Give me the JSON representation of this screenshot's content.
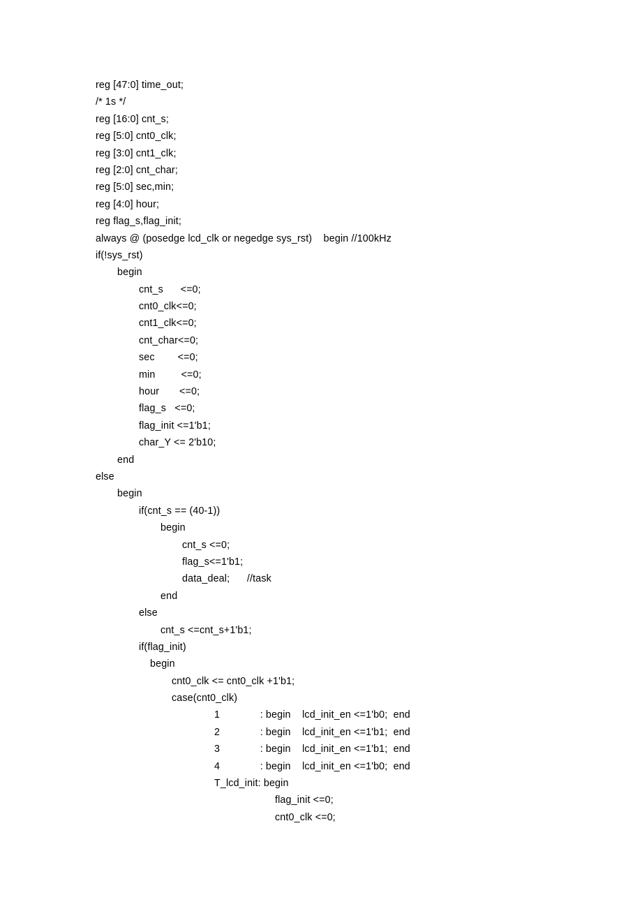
{
  "document": {
    "type": "verilog-source-listing",
    "page_background": "#ffffff",
    "text_color": "#000000"
  },
  "code": {
    "language": "verilog",
    "lines": [
      {
        "indent": "i0",
        "text": "reg [47:0] time_out;"
      },
      {
        "indent": "i0",
        "text": "/* 1s */"
      },
      {
        "indent": "i0",
        "text": "reg [16:0] cnt_s;"
      },
      {
        "indent": "i0",
        "text": "reg [5:0] cnt0_clk;"
      },
      {
        "indent": "i0",
        "text": "reg [3:0] cnt1_clk;"
      },
      {
        "indent": "i0",
        "text": "reg [2:0] cnt_char;"
      },
      {
        "indent": "i0",
        "text": "reg [5:0] sec,min;"
      },
      {
        "indent": "i0",
        "text": "reg [4:0] hour;"
      },
      {
        "indent": "i0",
        "text": "reg flag_s,flag_init;"
      },
      {
        "indent": "i0",
        "text": "always @ (posedge lcd_clk or negedge sys_rst)    begin //100kHz"
      },
      {
        "indent": "i0",
        "text": "if(!sys_rst)"
      },
      {
        "indent": "i1",
        "text": "begin"
      },
      {
        "indent": "i2",
        "text": "cnt_s      <=0;"
      },
      {
        "indent": "i2",
        "text": "cnt0_clk<=0;"
      },
      {
        "indent": "i2",
        "text": "cnt1_clk<=0;"
      },
      {
        "indent": "i2",
        "text": "cnt_char<=0;"
      },
      {
        "indent": "i2",
        "text": "sec        <=0;"
      },
      {
        "indent": "i2",
        "text": "min         <=0;"
      },
      {
        "indent": "i2",
        "text": "hour       <=0;"
      },
      {
        "indent": "i2",
        "text": "flag_s   <=0;"
      },
      {
        "indent": "i2",
        "text": "flag_init <=1'b1;"
      },
      {
        "indent": "i2",
        "text": "char_Y <= 2'b10;"
      },
      {
        "indent": "i1",
        "text": "end"
      },
      {
        "indent": "i0",
        "text": "else"
      },
      {
        "indent": "i1",
        "text": "begin"
      },
      {
        "indent": "i2",
        "text": "if(cnt_s == (40-1))"
      },
      {
        "indent": "i3",
        "text": "begin"
      },
      {
        "indent": "i4",
        "text": "cnt_s <=0;"
      },
      {
        "indent": "i4",
        "text": "flag_s<=1'b1;"
      },
      {
        "indent": "i4",
        "text": "data_deal;      //task"
      },
      {
        "indent": "i3",
        "text": "end"
      },
      {
        "indent": "i2",
        "text": "else"
      },
      {
        "indent": "i3",
        "text": "cnt_s <=cnt_s+1'b1;"
      },
      {
        "indent": "i2",
        "text": "if(flag_init)"
      },
      {
        "indent": "i-bgn",
        "text": "begin",
        "base": "i2"
      },
      {
        "indent": "i-stmt",
        "text": "cnt0_clk <= cnt0_clk +1'b1;",
        "base": "i2"
      },
      {
        "indent": "i-stmt",
        "text": "case(cnt0_clk)",
        "base": "i2"
      },
      {
        "indent": "i-case",
        "text": "1              : begin    lcd_init_en <=1'b0;  end",
        "base": "i2"
      },
      {
        "indent": "i-case",
        "text": "2              : begin    lcd_init_en <=1'b1;  end",
        "base": "i2"
      },
      {
        "indent": "i-case",
        "text": "3              : begin    lcd_init_en <=1'b1;  end",
        "base": "i2"
      },
      {
        "indent": "i-case",
        "text": "4              : begin    lcd_init_en <=1'b0;  end",
        "base": "i2"
      },
      {
        "indent": "i-tlbl",
        "text": "T_lcd_init: begin",
        "base": "i2"
      },
      {
        "indent": "i-tstmt",
        "text": "flag_init <=0;",
        "base": "i2"
      },
      {
        "indent": "i-tstmt",
        "text": "cnt0_clk <=0;",
        "base": "i2"
      }
    ]
  }
}
